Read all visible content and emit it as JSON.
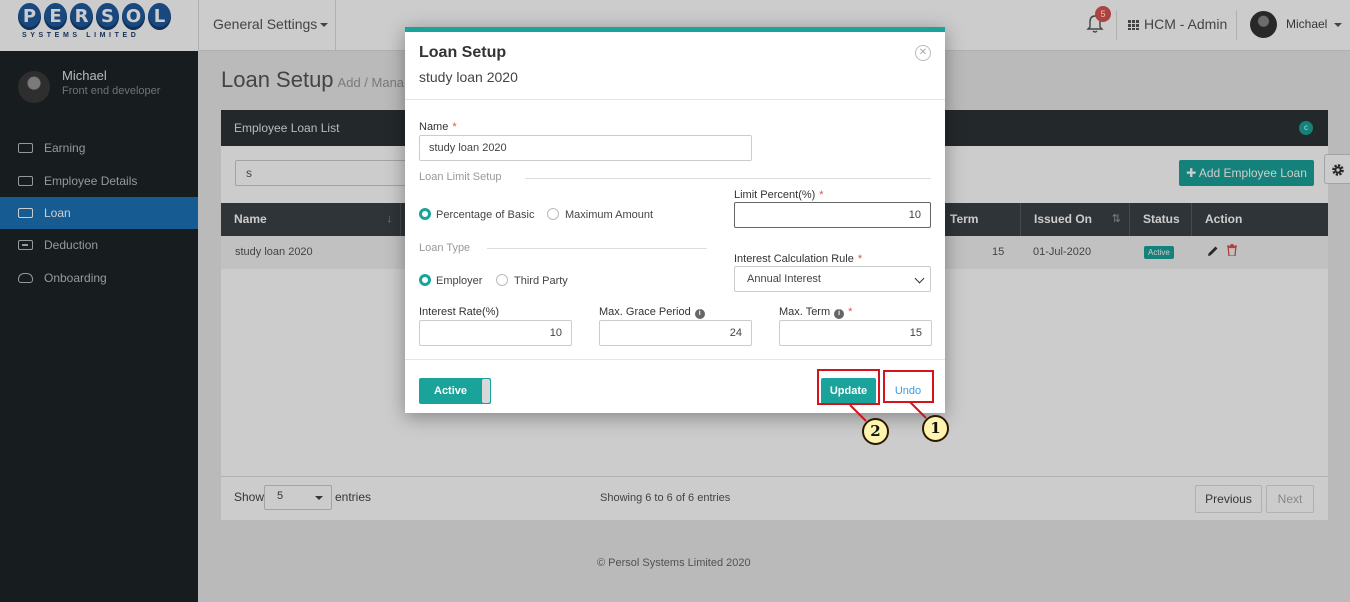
{
  "topbar": {
    "logo_text": "PERSOL",
    "logo_sub": "SYSTEMS LIMITED",
    "general_settings": "General Settings",
    "notif_count": "5",
    "workspace": "HCM - Admin",
    "user": "Michael"
  },
  "sidebar": {
    "user_name": "Michael",
    "user_role": "Front end developer",
    "items": [
      {
        "label": "Earning"
      },
      {
        "label": "Employee Details"
      },
      {
        "label": "Loan"
      },
      {
        "label": "Deduction"
      },
      {
        "label": "Onboarding"
      }
    ],
    "active": "Loan"
  },
  "page": {
    "title": "Loan Setup",
    "subtitle": "Add / Mana",
    "card_title": "Employee Loan List",
    "search_value": "s",
    "add_button": "Add Employee Loan",
    "columns": [
      "Name",
      "Term",
      "Issued On",
      "Status",
      "Action"
    ],
    "row": {
      "name": "study loan 2020",
      "term": "15",
      "issued_on": "01-Jul-2020",
      "status": "Active"
    },
    "show_label": "Show",
    "show_value": "5",
    "entries_label": "entries",
    "showing": "Showing 6 to 6 of 6 entries",
    "previous": "Previous",
    "next": "Next",
    "footer": "© Persol Systems Limited 2020"
  },
  "modal": {
    "title": "Loan Setup",
    "subtitle": "study loan 2020",
    "name_label": "Name",
    "name_value": "study loan 2020",
    "loan_limit_section": "Loan Limit Setup",
    "limit_options": [
      "Percentage of Basic",
      "Maximum Amount"
    ],
    "limit_selected": "Percentage of Basic",
    "limit_percent_label": "Limit Percent(%)",
    "limit_percent_value": "10",
    "loan_type_section": "Loan Type",
    "type_options": [
      "Employer",
      "Third Party"
    ],
    "type_selected": "Employer",
    "interest_rule_label": "Interest Calculation Rule",
    "interest_rule_value": "Annual Interest",
    "interest_rate_label": "Interest Rate(%)",
    "interest_rate_value": "10",
    "grace_label": "Max. Grace Period",
    "grace_value": "24",
    "term_label": "Max. Term",
    "term_value": "15",
    "active_toggle": "Active",
    "update_button": "Update",
    "undo_button": "Undo"
  },
  "callouts": [
    "1",
    "2"
  ],
  "colors": {
    "accent": "#1aa39a",
    "sidebar_active": "#1c74b8",
    "highlight": "#d4141b",
    "callout_fill": "#fff5b0"
  }
}
